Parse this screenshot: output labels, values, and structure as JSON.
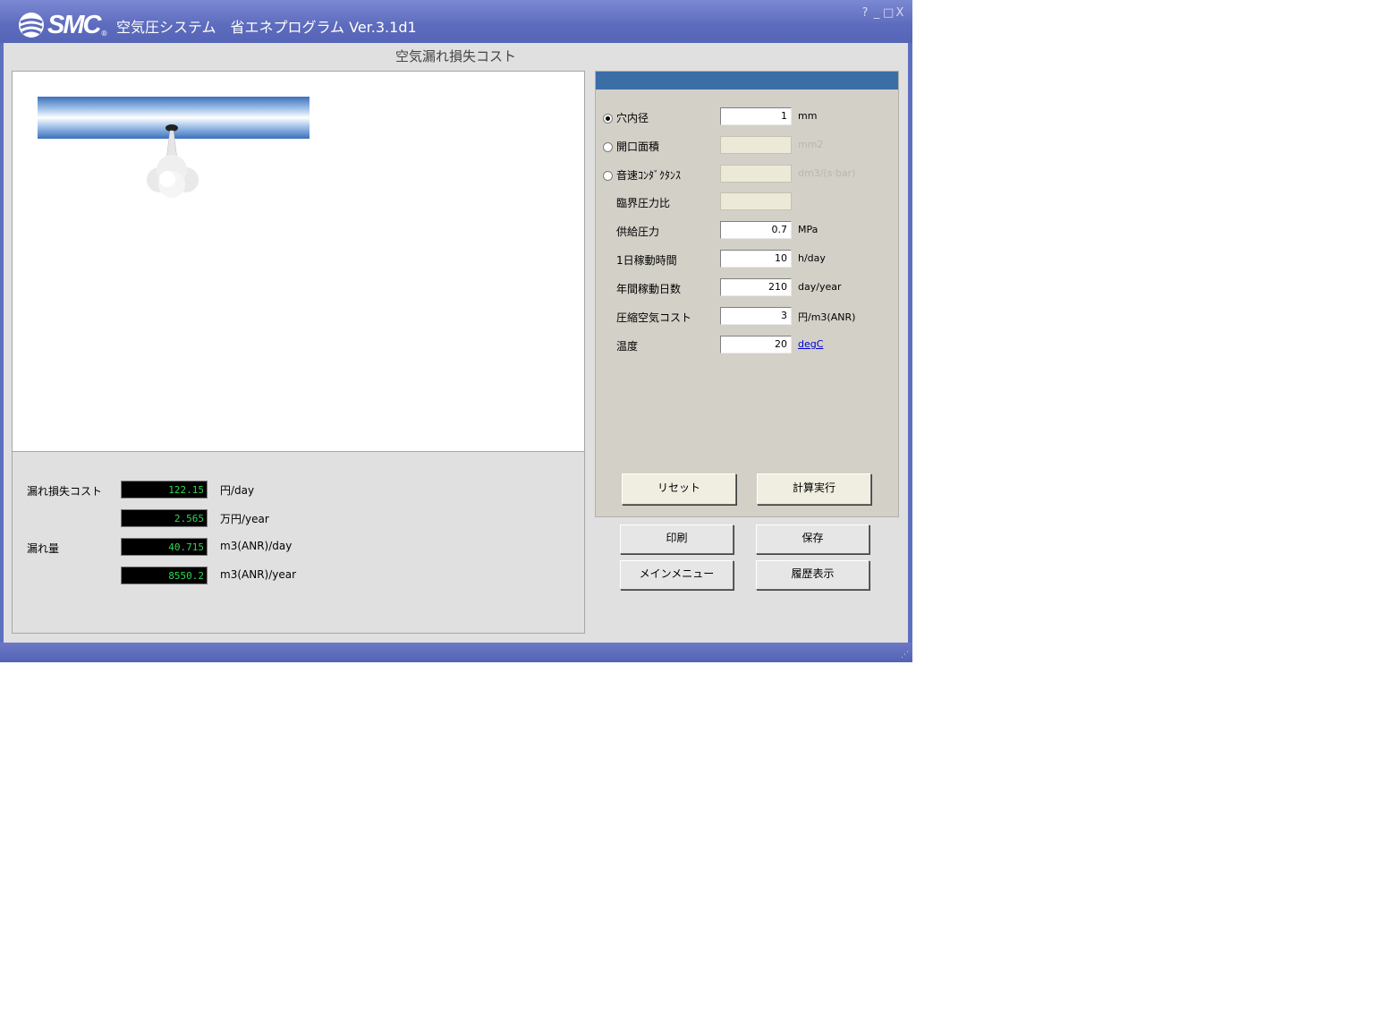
{
  "window": {
    "logo_text": "SMC",
    "logo_reg": "®",
    "app_title": "空気圧システム　省エネプログラム Ver.3.1d1",
    "controls": [
      "?",
      "_",
      "□",
      "X"
    ]
  },
  "screen_title": "空気漏れ損失コスト",
  "results": {
    "cost_label": "漏れ損失コスト",
    "leak_label": "漏れ量",
    "rows": [
      {
        "value": "122.15",
        "unit": "円/day"
      },
      {
        "value": "2.565",
        "unit": "万円/year"
      },
      {
        "value": "40.715",
        "unit": "m3(ANR)/day"
      },
      {
        "value": "8550.2",
        "unit": "m3(ANR)/year"
      }
    ]
  },
  "params": {
    "hole_diameter": {
      "label": "穴内径",
      "value": "1",
      "unit": "mm",
      "selected": true
    },
    "opening_area": {
      "label": "開口面積",
      "value": "",
      "unit": "mm2"
    },
    "sonic_conductance": {
      "label": "音速ｺﾝﾀﾞｸﾀﾝｽ",
      "value": "",
      "unit": "dm3/(s·bar)"
    },
    "critical_pressure_ratio": {
      "label": "臨界圧力比",
      "value": ""
    },
    "supply_pressure": {
      "label": "供給圧力",
      "value": "0.7",
      "unit": "MPa"
    },
    "daily_hours": {
      "label": "1日稼動時間",
      "value": "10",
      "unit": "h/day"
    },
    "annual_days": {
      "label": "年間稼動日数",
      "value": "210",
      "unit": "day/year"
    },
    "air_cost": {
      "label": "圧縮空気コスト",
      "value": "3",
      "unit": "円/m3(ANR)"
    },
    "temperature": {
      "label": "温度",
      "value": "20",
      "unit": "degC"
    }
  },
  "buttons": {
    "reset": "リセット",
    "calculate": "計算実行",
    "print": "印刷",
    "save": "保存",
    "main_menu": "メインメニュー",
    "history": "履歴表示"
  },
  "colors": {
    "titlebar": "#5d6bbd",
    "panel_header": "#3a6ea5",
    "result_text": "#31d651"
  }
}
